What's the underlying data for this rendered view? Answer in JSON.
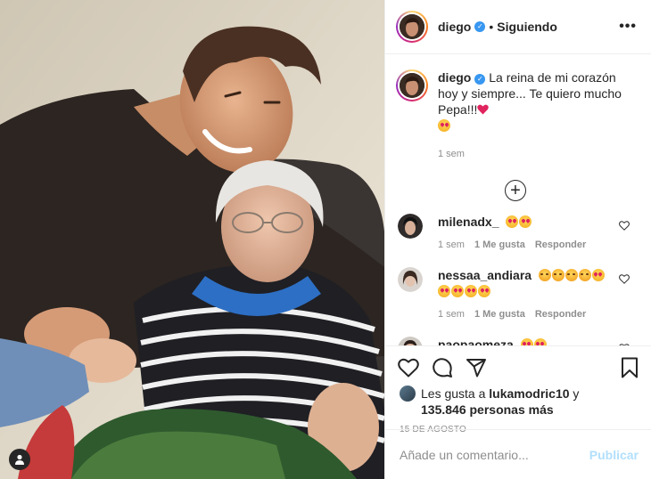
{
  "post": {
    "username": "diego",
    "verified_icon": "verified-check-icon",
    "separator": "•",
    "follow_status": "Siguiendo",
    "more_icon": "more-options-icon",
    "more_glyph": "•••"
  },
  "caption": {
    "username": "diego",
    "text": "La reina de mi corazón hoy y siempre... Te quiero mucho Pepa!!!",
    "emojis": [
      "red-heart",
      "face-blowing-kiss"
    ],
    "time": "1 sem"
  },
  "load_more_icon": "plus-circle-icon",
  "load_more_glyph": "+",
  "comments": [
    {
      "username": "milenadx_",
      "emojis": [
        "heart-eyes",
        "heart-eyes"
      ],
      "time": "1 sem",
      "likes": "1 Me gusta",
      "reply": "Responder"
    },
    {
      "username": "nessaa_andiara",
      "emojis": [
        "smiling-face",
        "smiling-face",
        "smiling-face",
        "smiling-face",
        "heart-eyes",
        "heart-eyes",
        "heart-eyes",
        "heart-eyes",
        "heart-eyes"
      ],
      "time": "1 sem",
      "likes": "1 Me gusta",
      "reply": "Responder"
    },
    {
      "username": "paopaomeza",
      "emojis": [
        "heart-eyes",
        "heart-eyes"
      ]
    }
  ],
  "likes": {
    "prefix": "Les gusta a ",
    "user": "lukamodric10",
    "connector": " y",
    "count": "135.846 personas más"
  },
  "date": "15 DE AGOSTO",
  "add_comment": {
    "placeholder": "Añade un comentario...",
    "publish_label": "Publicar"
  },
  "colors": {
    "accent_blue": "#3897f0",
    "publish_disabled": "#b2dffc",
    "muted": "#8e8e8e",
    "text": "#262626",
    "border": "#efefef"
  }
}
